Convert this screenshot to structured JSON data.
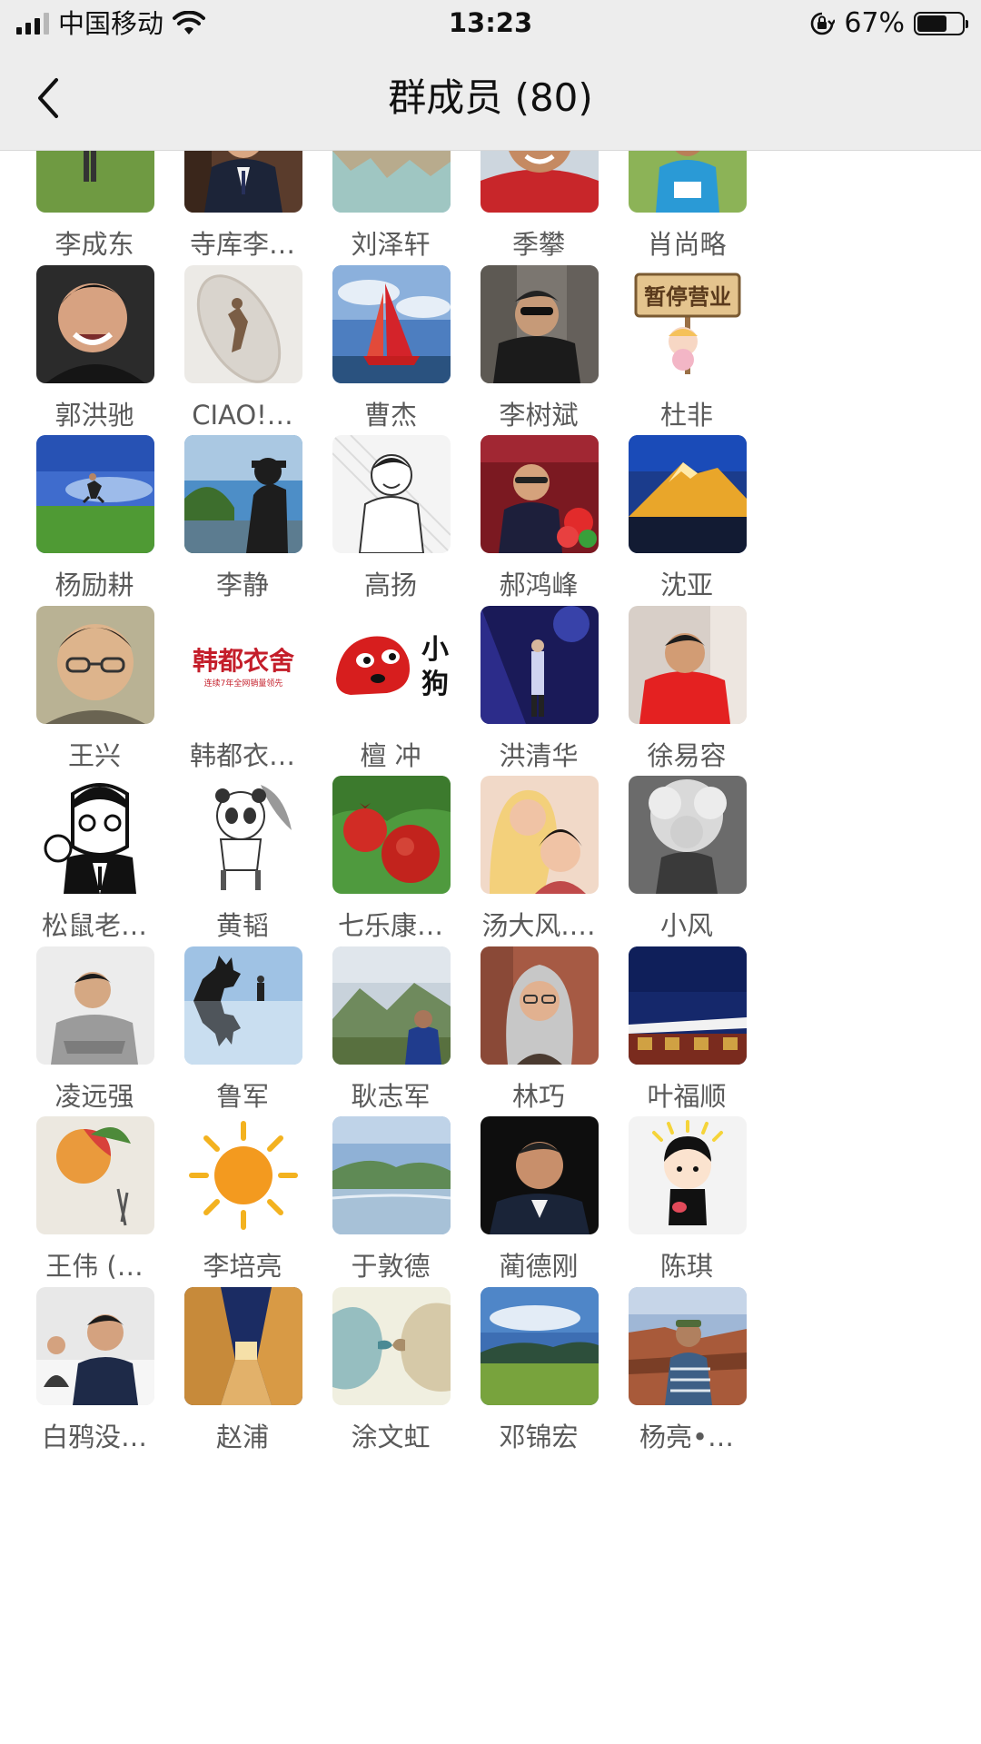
{
  "status_bar": {
    "carrier": "中国移动",
    "time": "13:23",
    "battery": "67%",
    "battery_fraction": 0.67
  },
  "nav": {
    "title": "群成员 (80)"
  },
  "avatar_texts": {
    "sign": "暂停营业",
    "brand_line1": "韩都衣舍",
    "brand_line2": "连续7年全网销量领先",
    "dog_label": "小狗"
  },
  "members": [
    {
      "name": "李成东",
      "avatar": "golfer"
    },
    {
      "name": "寺库李…",
      "avatar": "suit-man"
    },
    {
      "name": "刘泽轩",
      "avatar": "lake-mountains"
    },
    {
      "name": "季攀",
      "avatar": "sunglasses-man"
    },
    {
      "name": "肖尚略",
      "avatar": "grassland-man"
    },
    {
      "name": "郭洪驰",
      "avatar": "smiling-man"
    },
    {
      "name": "CIAO!…",
      "avatar": "boat-figure"
    },
    {
      "name": "曹杰",
      "avatar": "red-sailboat"
    },
    {
      "name": "李树斌",
      "avatar": "street-man"
    },
    {
      "name": "杜非",
      "avatar": "closed-sign"
    },
    {
      "name": "杨励耕",
      "avatar": "jumping-person"
    },
    {
      "name": "李静",
      "avatar": "silhouette"
    },
    {
      "name": "高扬",
      "avatar": "sketch-man"
    },
    {
      "name": "郝鸿峰",
      "avatar": "stage-speaker"
    },
    {
      "name": "沈亚",
      "avatar": "golden-peak"
    },
    {
      "name": "王兴",
      "avatar": "glasses-man"
    },
    {
      "name": "韩都衣…",
      "avatar": "brand-logo"
    },
    {
      "name": "檀 冲",
      "avatar": "red-dog"
    },
    {
      "name": "洪清华",
      "avatar": "blue-stage"
    },
    {
      "name": "徐易容",
      "avatar": "red-hoodie"
    },
    {
      "name": "松鼠老…",
      "avatar": "comic-man"
    },
    {
      "name": "黄韬",
      "avatar": "panda-sketch"
    },
    {
      "name": "七乐康…",
      "avatar": "pomegranates"
    },
    {
      "name": "汤大风.…",
      "avatar": "mother-child"
    },
    {
      "name": "小风",
      "avatar": "curly-child"
    },
    {
      "name": "凌远强",
      "avatar": "arms-crossed"
    },
    {
      "name": "鲁军",
      "avatar": "godzilla"
    },
    {
      "name": "耿志军",
      "avatar": "mountain-valley"
    },
    {
      "name": "林巧",
      "avatar": "gray-hair-woman"
    },
    {
      "name": "叶福顺",
      "avatar": "temple-night"
    },
    {
      "name": "王伟 (…",
      "avatar": "painted-peach"
    },
    {
      "name": "李培亮",
      "avatar": "sun"
    },
    {
      "name": "于敦德",
      "avatar": "river-hills"
    },
    {
      "name": "蔺德刚",
      "avatar": "dark-portrait"
    },
    {
      "name": "陈琪",
      "avatar": "cartoon-boy"
    },
    {
      "name": "白鸦没…",
      "avatar": "meeting-man"
    },
    {
      "name": "赵浦",
      "avatar": "alley-night"
    },
    {
      "name": "涂文虹",
      "avatar": "kiss-sketch"
    },
    {
      "name": "邓锦宏",
      "avatar": "green-landscape"
    },
    {
      "name": "杨亮•…",
      "avatar": "canyon-man"
    }
  ]
}
